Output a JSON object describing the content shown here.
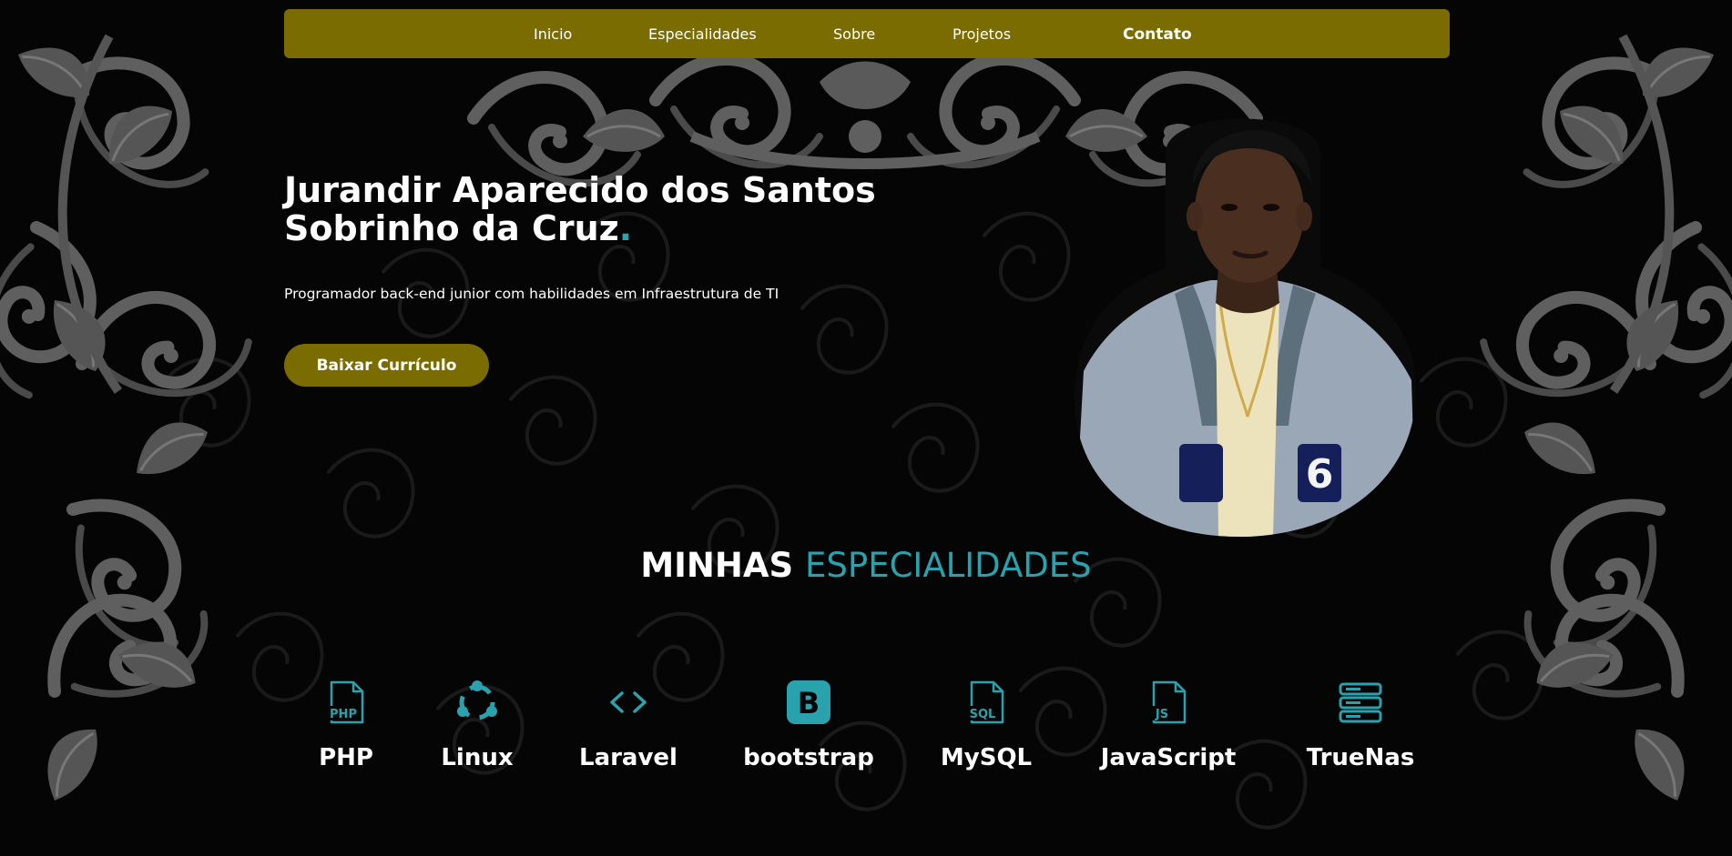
{
  "colors": {
    "background": "#050505",
    "accent_gold": "#7b6c00",
    "accent_teal": "#2aa2ad",
    "ornament": "#5f5f5f",
    "text": "#ffffff"
  },
  "nav": {
    "items": [
      {
        "label": "Inicio",
        "active": false
      },
      {
        "label": "Especialidades",
        "active": false
      },
      {
        "label": "Sobre",
        "active": false
      },
      {
        "label": "Projetos",
        "active": false
      },
      {
        "label": "Contato",
        "active": true
      }
    ]
  },
  "hero": {
    "title_line1": "Jurandir Aparecido dos Santos",
    "title_line2": "Sobrinho da Cruz",
    "title_dot": ".",
    "subtitle": "Programador back-end junior com habilidades em Infraestrutura de TI",
    "cv_button": "Baixar Currículo",
    "portrait": "profile-photo"
  },
  "skills": {
    "title_main": "MINHAS",
    "title_accent": "ESPECIALIDADES",
    "items": [
      {
        "label": "PHP",
        "icon": "php-file-icon",
        "icon_text": "PHP"
      },
      {
        "label": "Linux",
        "icon": "ubuntu-icon"
      },
      {
        "label": "Laravel",
        "icon": "code-brackets-icon"
      },
      {
        "label": "bootstrap",
        "icon": "bootstrap-icon",
        "icon_text": "B"
      },
      {
        "label": "MySQL",
        "icon": "sql-file-icon",
        "icon_text": "SQL"
      },
      {
        "label": "JavaScript",
        "icon": "js-file-icon",
        "icon_text": "JS"
      },
      {
        "label": "TrueNas",
        "icon": "server-stack-icon"
      }
    ]
  }
}
